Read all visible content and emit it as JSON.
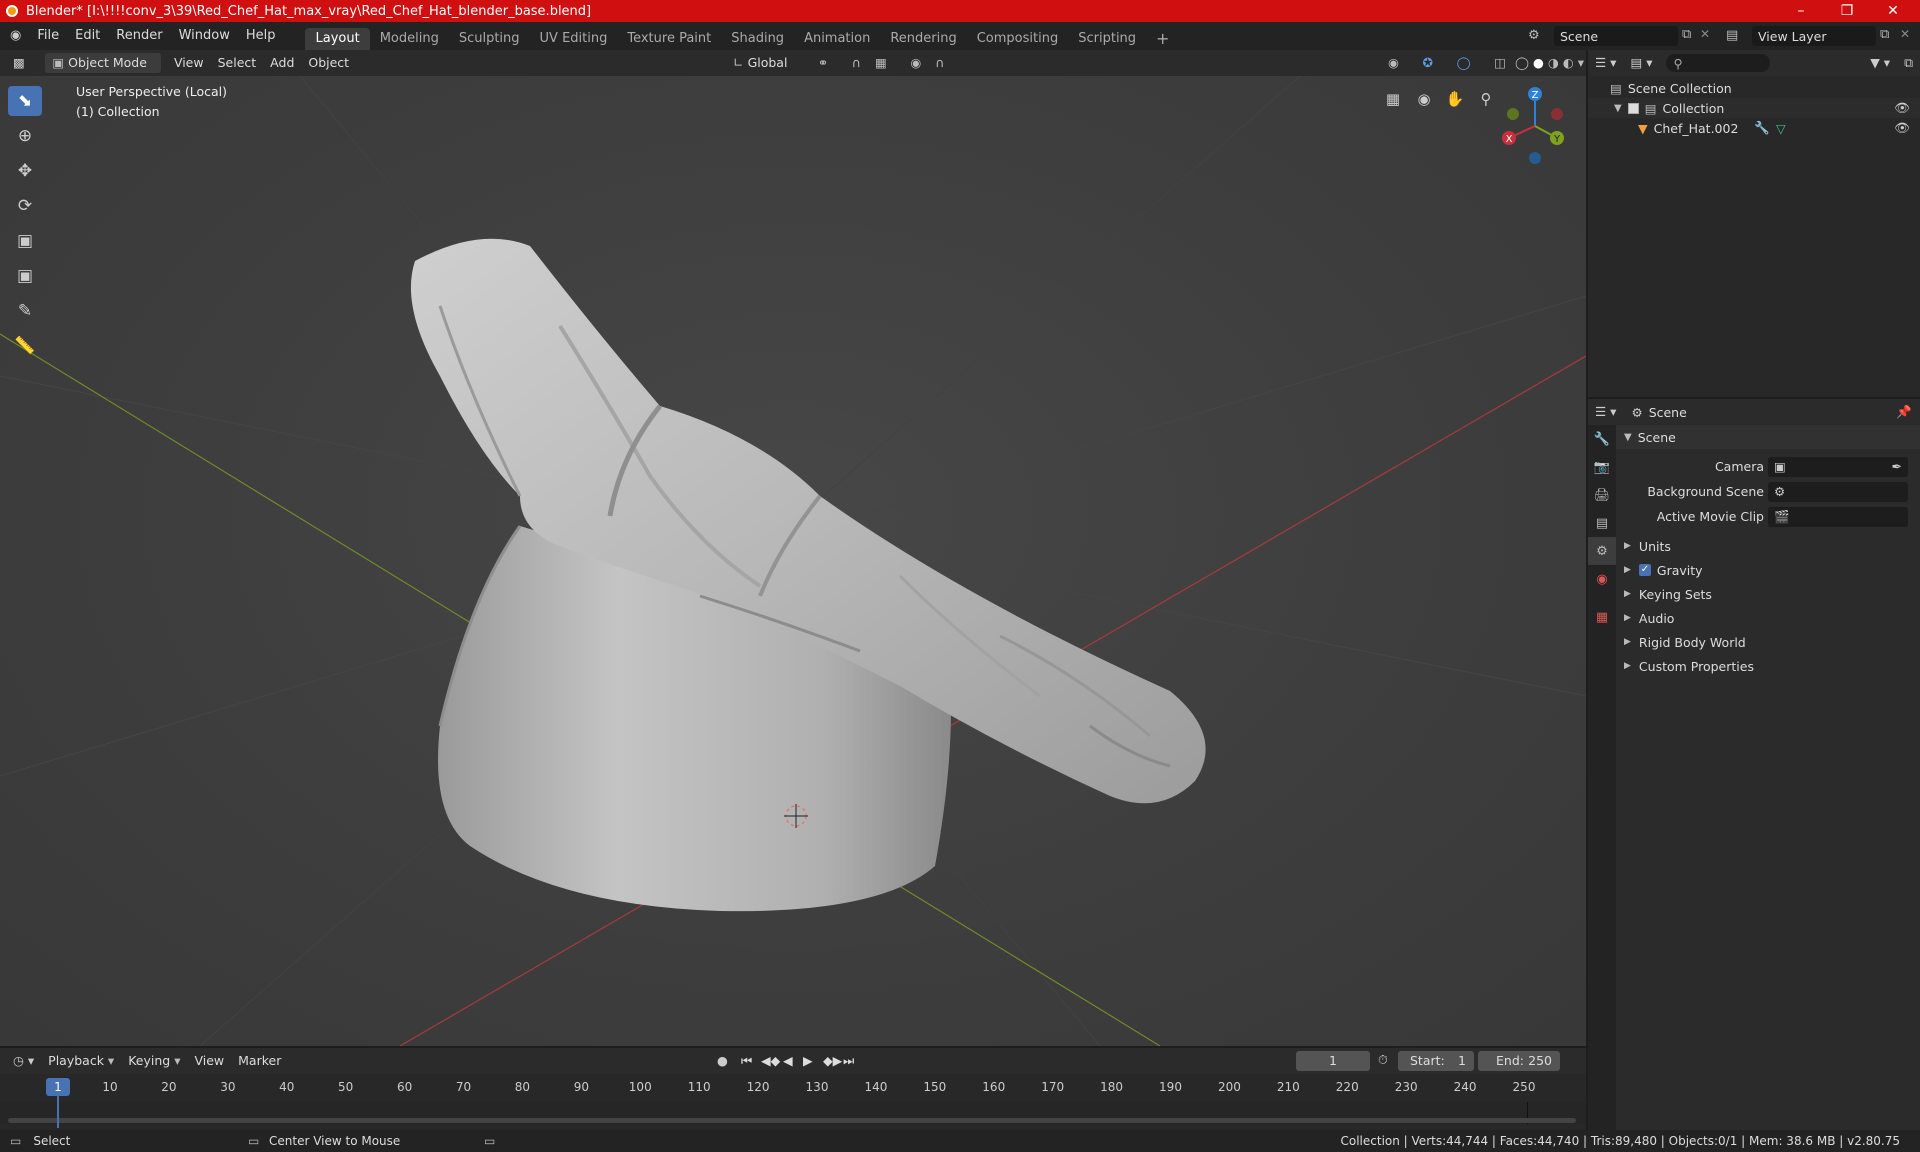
{
  "window": {
    "title": "Blender* [I:\\!!!!conv_3\\39\\Red_Chef_Hat_max_vray\\Red_Chef_Hat_blender_base.blend]"
  },
  "menu": [
    "File",
    "Edit",
    "Render",
    "Window",
    "Help"
  ],
  "workspaces": [
    "Layout",
    "Modeling",
    "Sculpting",
    "UV Editing",
    "Texture Paint",
    "Shading",
    "Animation",
    "Rendering",
    "Compositing",
    "Scripting"
  ],
  "scene_name": "Scene",
  "view_layer": "View Layer",
  "viewport_header": {
    "mode": "Object Mode",
    "items": [
      "View",
      "Select",
      "Add",
      "Object"
    ],
    "orientation": "Global"
  },
  "viewport": {
    "perspective": "User Perspective (Local)",
    "collection": "(1) Collection"
  },
  "gizmo": {
    "x": "X",
    "y": "Y",
    "z": "Z"
  },
  "outliner": {
    "scene_collection": "Scene Collection",
    "collection": "Collection",
    "object": "Chef_Hat.002"
  },
  "properties": {
    "header": "Scene",
    "panel": "Scene",
    "fields": {
      "camera": "Camera",
      "background_scene": "Background Scene",
      "active_movie_clip": "Active Movie Clip"
    },
    "sections": [
      "Units",
      "Gravity",
      "Keying Sets",
      "Audio",
      "Rigid Body World",
      "Custom Properties"
    ]
  },
  "timeline": {
    "menus": [
      "Playback",
      "Keying",
      "View",
      "Marker"
    ],
    "current_frame": "1",
    "start_label": "Start:",
    "start": "1",
    "end_label": "End:",
    "end": "250",
    "ticks": [
      "1",
      "10",
      "20",
      "30",
      "40",
      "50",
      "60",
      "70",
      "80",
      "90",
      "100",
      "110",
      "120",
      "130",
      "140",
      "150",
      "160",
      "170",
      "180",
      "190",
      "200",
      "210",
      "220",
      "230",
      "240",
      "250"
    ]
  },
  "status": {
    "left": "Select",
    "middle": "Center View to Mouse",
    "right": "Collection | Verts:44,744 | Faces:44,740 | Tris:89,480 | Objects:0/1 | Mem: 38.6 MB | v2.80.75"
  },
  "colors": {
    "accent": "#4772b3",
    "title_bar": "#cf0f10",
    "x_axis": "#c9303c",
    "y_axis": "#7fa31f",
    "z_axis": "#2c82d5"
  }
}
